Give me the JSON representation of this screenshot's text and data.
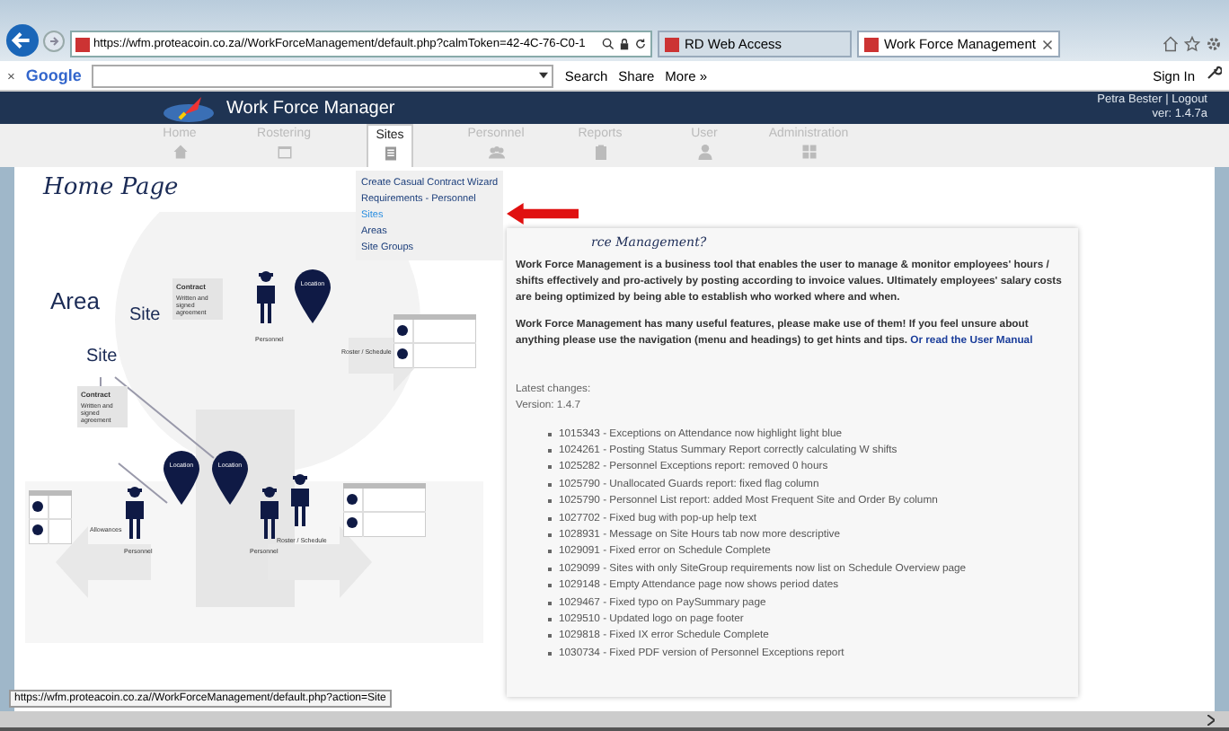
{
  "browser": {
    "address": "https://wfm.proteacoin.co.za//WorkForceManagement/default.php?calmToken=42-4C-76-C0-1",
    "tabs": [
      {
        "title": "RD Web Access",
        "selected": false
      },
      {
        "title": "Work Force Management",
        "selected": true
      }
    ]
  },
  "toolbar": {
    "brand": "Google",
    "close": "×",
    "buttons": [
      "Search",
      "Share",
      "More »"
    ],
    "sign_in": "Sign In"
  },
  "app": {
    "title": "Work Force Manager",
    "user": "Petra Bester",
    "separator": "|",
    "logout": "Logout",
    "version": "ver: 1.4.7a"
  },
  "nav": [
    {
      "label": "Home",
      "selected": false
    },
    {
      "label": "Rostering",
      "selected": false
    },
    {
      "label": "Sites",
      "selected": true
    },
    {
      "label": "Personnel",
      "selected": false
    },
    {
      "label": "Reports",
      "selected": false
    },
    {
      "label": "User",
      "selected": false
    },
    {
      "label": "Administration",
      "selected": false
    }
  ],
  "menu": [
    {
      "label": "Create Casual Contract Wizard",
      "selected": false
    },
    {
      "label": "Requirements - Personnel",
      "selected": false
    },
    {
      "label": "Sites",
      "selected": true
    },
    {
      "label": "Areas",
      "selected": false
    },
    {
      "label": "Site Groups",
      "selected": false
    }
  ],
  "page_title": "Home Page",
  "diagram": {
    "area": "Area",
    "sites": [
      "Site",
      "Site"
    ],
    "contracts": [
      {
        "title": "Contract",
        "text": "Written and signed agreement"
      },
      {
        "title": "Contract",
        "text": "Written and signed agreement"
      }
    ],
    "locations": [
      "Location",
      "Location",
      "Location"
    ],
    "personnel": [
      "Personnel",
      "Personnel",
      "Personnel"
    ],
    "rosters": [
      "Roster / Schedule",
      "Roster / Schedule"
    ],
    "allowances": "Allowances"
  },
  "card": {
    "heading": "rce Management?",
    "paragraphs": [
      "Work Force Management is a business tool that enables the user to manage & monitor employees' hours / shifts effectively and pro-actively by posting according to invoice values. Ultimately employees' salary costs are being optimized by being able to establish who worked where and when.",
      "Work Force Management has many useful features, please make use of them! If you feel unsure about anything please use the navigation (menu and headings) to get hints and tips."
    ],
    "link": "Or read the User Manual",
    "changes_title": "Latest changes:",
    "version": "Version: 1.4.7",
    "changes": [
      "1015343 - Exceptions on Attendance now highlight light blue",
      "1024261 - Posting Status Summary Report correctly calculating W shifts",
      "1025282 - Personnel Exceptions report: removed 0 hours",
      "1025790 - Unallocated Guards report: fixed flag column",
      "1025790 - Personnel List report: added Most Frequent Site and Order By column",
      "1027702 - Fixed bug with pop-up help text",
      "1028931 - Message on Site Hours tab now more descriptive",
      "1029091 - Fixed error on Schedule Complete",
      "1029099 - Sites with only SiteGroup requirements now list on Schedule Overview page",
      "1029148 - Empty Attendance page now shows period dates",
      "1029467 - Fixed typo on PaySummary page",
      "1029510 - Updated logo on page footer",
      "1029818 - Fixed IX error Schedule Complete",
      "1030734 - Fixed PDF version of Personnel Exceptions report"
    ]
  },
  "status_url": "https://wfm.proteacoin.co.za//WorkForceManagement/default.php?action=Site"
}
